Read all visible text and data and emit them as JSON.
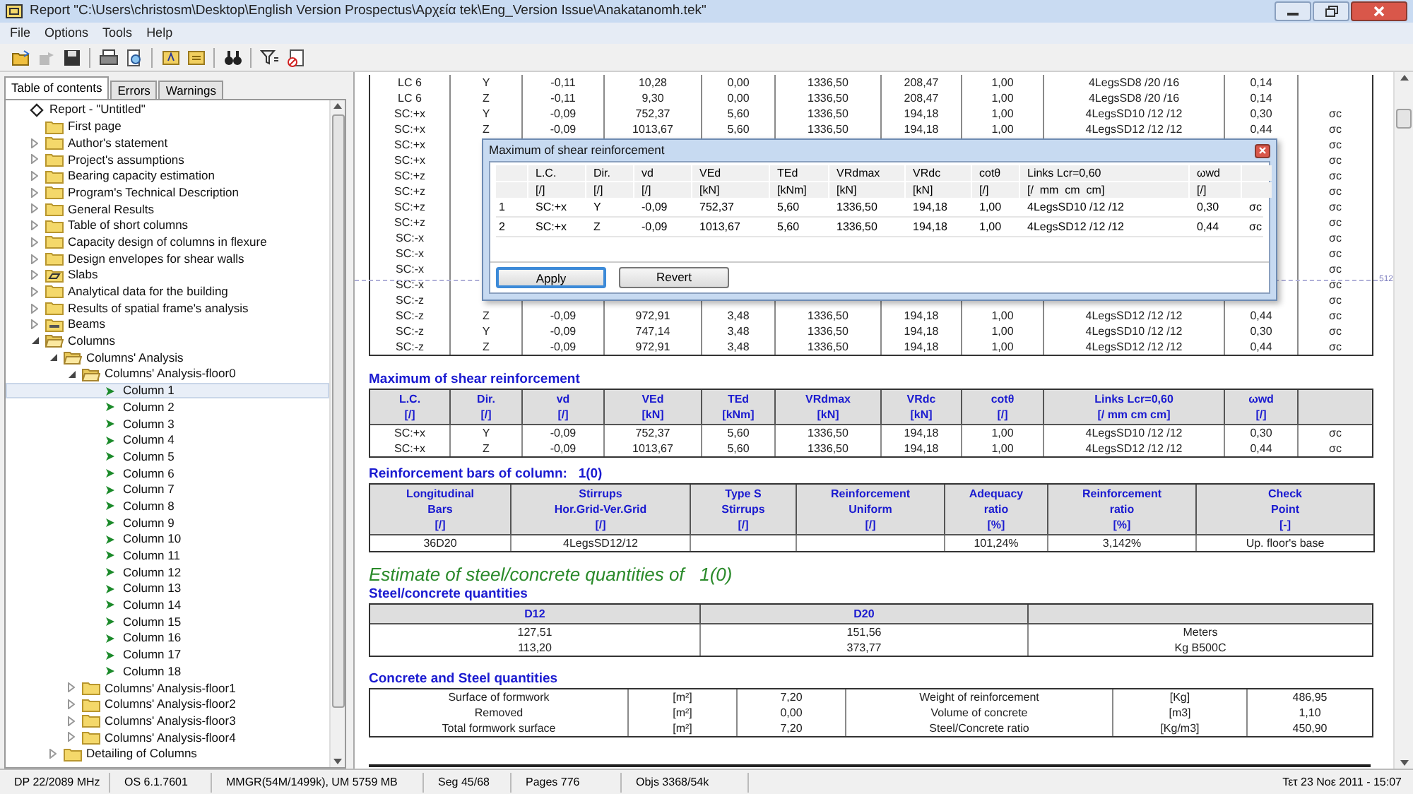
{
  "window": {
    "title": "Report \"C:\\Users\\christosm\\Desktop\\English Version Prospectus\\Αρχεία tek\\Eng_Version Issue\\Anakatanomh.tek\""
  },
  "menu": [
    "File",
    "Options",
    "Tools",
    "Help"
  ],
  "sidebar": {
    "tabs": [
      {
        "label": "Table of contents",
        "selected": true
      },
      {
        "label": "Errors",
        "selected": false
      },
      {
        "label": "Warnings",
        "selected": false
      }
    ],
    "tree": [
      {
        "label": "Report - \"Untitled\"",
        "kind": "diamond",
        "selected": false,
        "children": [
          {
            "label": "First page",
            "kind": "folder",
            "selected": false
          },
          {
            "label": "Author's statement",
            "kind": "folder",
            "expanded": false,
            "selected": false
          },
          {
            "label": "Project's assumptions",
            "kind": "folder",
            "expanded": false,
            "selected": false
          },
          {
            "label": "Bearing capacity estimation",
            "kind": "folder",
            "expanded": false,
            "selected": false
          },
          {
            "label": "Program's Technical Description",
            "kind": "folder",
            "expanded": false,
            "selected": false
          },
          {
            "label": "General Results",
            "kind": "folder",
            "expanded": false,
            "selected": false
          },
          {
            "label": "Table of short columns",
            "kind": "folder",
            "expanded": false,
            "selected": false
          },
          {
            "label": "Capacity design of columns in flexure",
            "kind": "folder",
            "expanded": false,
            "selected": false
          },
          {
            "label": "Design envelopes for shear walls",
            "kind": "folder",
            "expanded": false,
            "selected": false
          },
          {
            "label": "Slabs",
            "kind": "slab",
            "expanded": false,
            "selected": false
          },
          {
            "label": "Analytical data for the building",
            "kind": "folder",
            "expanded": false,
            "selected": false
          },
          {
            "label": "Results of spatial frame's analysis",
            "kind": "folder",
            "expanded": false,
            "selected": false
          },
          {
            "label": "Beams",
            "kind": "beam",
            "expanded": false,
            "selected": false
          },
          {
            "label": "Columns",
            "kind": "open",
            "expanded": true,
            "selected": false,
            "children": [
              {
                "label": "Columns' Analysis",
                "kind": "open",
                "expanded": true,
                "selected": false,
                "children": [
                  {
                    "label": "Columns' Analysis-floor0",
                    "kind": "open",
                    "expanded": true,
                    "selected": false,
                    "children": [
                      {
                        "label": "Column 1",
                        "kind": "arrow",
                        "selected": true
                      },
                      {
                        "label": "Column 2",
                        "kind": "arrow",
                        "selected": false
                      },
                      {
                        "label": "Column 3",
                        "kind": "arrow",
                        "selected": false
                      },
                      {
                        "label": "Column 4",
                        "kind": "arrow",
                        "selected": false
                      },
                      {
                        "label": "Column 5",
                        "kind": "arrow",
                        "selected": false
                      },
                      {
                        "label": "Column 6",
                        "kind": "arrow",
                        "selected": false
                      },
                      {
                        "label": "Column 7",
                        "kind": "arrow",
                        "selected": false
                      },
                      {
                        "label": "Column 8",
                        "kind": "arrow",
                        "selected": false
                      },
                      {
                        "label": "Column 9",
                        "kind": "arrow",
                        "selected": false
                      },
                      {
                        "label": "Column 10",
                        "kind": "arrow",
                        "selected": false
                      },
                      {
                        "label": "Column 11",
                        "kind": "arrow",
                        "selected": false
                      },
                      {
                        "label": "Column 12",
                        "kind": "arrow",
                        "selected": false
                      },
                      {
                        "label": "Column 13",
                        "kind": "arrow",
                        "selected": false
                      },
                      {
                        "label": "Column 14",
                        "kind": "arrow",
                        "selected": false
                      },
                      {
                        "label": "Column 15",
                        "kind": "arrow",
                        "selected": false
                      },
                      {
                        "label": "Column 16",
                        "kind": "arrow",
                        "selected": false
                      },
                      {
                        "label": "Column 17",
                        "kind": "arrow",
                        "selected": false
                      },
                      {
                        "label": "Column 18",
                        "kind": "arrow",
                        "selected": false
                      }
                    ]
                  },
                  {
                    "label": "Columns' Analysis-floor1",
                    "kind": "folder",
                    "expanded": false,
                    "selected": false
                  },
                  {
                    "label": "Columns' Analysis-floor2",
                    "kind": "folder",
                    "expanded": false,
                    "selected": false
                  },
                  {
                    "label": "Columns' Analysis-floor3",
                    "kind": "folder",
                    "expanded": false,
                    "selected": false
                  },
                  {
                    "label": "Columns' Analysis-floor4",
                    "kind": "folder",
                    "expanded": false,
                    "selected": false
                  }
                ]
              },
              {
                "label": "Detailing of Columns",
                "kind": "folder",
                "expanded": false,
                "selected": false
              }
            ]
          }
        ]
      }
    ]
  },
  "report": {
    "top_table": {
      "rows": [
        {
          "lc": "LC 6",
          "values": [
            "Y",
            "-0,11",
            "10,28",
            "0,00",
            "1336,50",
            "208,47",
            "1,00",
            "4LegsSD8 /20 /16",
            "0,14"
          ]
        },
        {
          "lc": "LC 6",
          "values": [
            "Z",
            "-0,11",
            "9,30",
            "0,00",
            "1336,50",
            "208,47",
            "1,00",
            "4LegsSD8 /20 /16",
            "0,14"
          ]
        },
        {
          "lc": "SC:+x",
          "values": [
            "Y",
            "-0,09",
            "752,37",
            "5,60",
            "1336,50",
            "194,18",
            "1,00",
            "4LegsSD10 /12 /12",
            "0,30"
          ],
          "last": "σc"
        },
        {
          "lc": "SC:+x",
          "values": [
            "Z",
            "-0,09",
            "1013,67",
            "5,60",
            "1336,50",
            "194,18",
            "1,00",
            "4LegsSD12 /12 /12",
            "0,44"
          ],
          "last": "σc"
        },
        {
          "lc": "SC:+x",
          "last": "σc"
        },
        {
          "lc": "SC:+x",
          "last": "σc"
        },
        {
          "lc": "SC:+z",
          "last": "σc"
        },
        {
          "lc": "SC:+z",
          "last": "σc"
        },
        {
          "lc": "SC:+z",
          "last": "σc"
        },
        {
          "lc": "SC:+z",
          "last": "σc"
        },
        {
          "lc": "SC:-x",
          "last": "σc"
        },
        {
          "lc": "SC:-x",
          "last": "σc"
        },
        {
          "lc": "SC:-x",
          "last": "σc"
        },
        {
          "lc": "SC:-x",
          "last": "σc"
        },
        {
          "lc": "SC:-z",
          "last": "σc"
        },
        {
          "lc": "SC:-z",
          "values": [
            "Z",
            "-0,09",
            "972,91",
            "3,48",
            "1336,50",
            "194,18",
            "1,00",
            "4LegsSD12 /12 /12",
            "0,44"
          ],
          "last": "σc"
        },
        {
          "lc": "SC:-z",
          "values": [
            "Y",
            "-0,09",
            "747,14",
            "3,48",
            "1336,50",
            "194,18",
            "1,00",
            "4LegsSD10 /12 /12",
            "0,30"
          ],
          "last": "σc"
        },
        {
          "lc": "SC:-z",
          "values": [
            "Z",
            "-0,09",
            "972,91",
            "3,48",
            "1336,50",
            "194,18",
            "1,00",
            "4LegsSD12 /12 /12",
            "0,44"
          ],
          "last": "σc"
        }
      ]
    },
    "page_marker": "512",
    "shear_table": {
      "title": "Maximum of shear reinforcement",
      "header": [
        [
          "L.C.",
          "[/]"
        ],
        [
          "Dir.",
          "[/]"
        ],
        [
          "vd",
          "[/]"
        ],
        [
          "VEd",
          "[kN]"
        ],
        [
          "TEd",
          "[kNm]"
        ],
        [
          "VRdmax",
          "[kN]"
        ],
        [
          "VRdc",
          "[kN]"
        ],
        [
          "cotθ",
          "[/]"
        ],
        [
          "Links Lcr=0,60",
          "[/  mm  cm  cm]"
        ],
        [
          "ωwd",
          "[/]"
        ]
      ],
      "rows": [
        [
          "SC:+x",
          "Y",
          "-0,09",
          "752,37",
          "5,60",
          "1336,50",
          "194,18",
          "1,00",
          "4LegsSD10 /12 /12",
          "0,30",
          "σc"
        ],
        [
          "SC:+x",
          "Z",
          "-0,09",
          "1013,67",
          "5,60",
          "1336,50",
          "194,18",
          "1,00",
          "4LegsSD12 /12 /12",
          "0,44",
          "σc"
        ]
      ]
    },
    "bars_table": {
      "title": "Reinforcement bars of column:   1(0)",
      "header": [
        [
          "Longitudinal",
          "Bars",
          "[/]"
        ],
        [
          "Stirrups",
          "Hor.Grid-Ver.Grid",
          "[/]"
        ],
        [
          "Type S",
          "Stirrups",
          "[/]"
        ],
        [
          "Reinforcement",
          "Uniform",
          "[/]"
        ],
        [
          "Adequacy",
          "ratio",
          "[%]"
        ],
        [
          "Reinforcement",
          "ratio",
          "[%]"
        ],
        [
          "Check",
          "Point",
          "[-]"
        ]
      ],
      "rows": [
        [
          "36D20",
          "4LegsSD12/12",
          null,
          null,
          "101,24%",
          "3,142%",
          "Up. floor's base"
        ]
      ]
    },
    "estimate_title": "Estimate of steel/concrete quantities of   1(0)",
    "steel_table": {
      "title": "Steel/concrete quantities",
      "header": [
        [
          "D12"
        ],
        [
          "D20"
        ]
      ],
      "rows": [
        [
          "127,51",
          "151,56",
          "Meters"
        ],
        [
          "113,20",
          "373,77",
          "Kg B500C"
        ]
      ]
    },
    "concrete_table": {
      "title": "Concrete and Steel quantities",
      "rows": [
        [
          "Surface of formwork",
          "[m²]",
          "7,20",
          "Weight of reinforcement",
          "[Kg]",
          "486,95"
        ],
        [
          "Removed",
          "[m²]",
          "0,00",
          "Volume of concrete",
          "[m3]",
          "1,10"
        ],
        [
          "Total formwork surface",
          "[m²]",
          "7,20",
          "Steel/Concrete ratio",
          "[Kg/m3]",
          "450,90"
        ]
      ]
    }
  },
  "dialog": {
    "title": "Maximum of shear reinforcement",
    "header": [
      "L.C.",
      "Dir.",
      "vd",
      "VEd",
      "TEd",
      "VRdmax",
      "VRdc",
      "cotθ",
      "Links Lcr=0,60",
      "ωwd"
    ],
    "units": [
      "[/]",
      "[/]",
      "[/]",
      "[kN]",
      "[kNm]",
      "[kN]",
      "[kN]",
      "[/]",
      "[/  mm  cm  cm]",
      "[/]"
    ],
    "rows": [
      {
        "index": "1",
        "cells": [
          "SC:+x",
          "Y",
          "-0,09",
          "752,37",
          "5,60",
          "1336,50",
          "194,18",
          "1,00",
          "4LegsSD10 /12 /12",
          "0,30",
          "σc"
        ]
      },
      {
        "index": "2",
        "cells": [
          "SC:+x",
          "Z",
          "-0,09",
          "1013,67",
          "5,60",
          "1336,50",
          "194,18",
          "1,00",
          "4LegsSD12 /12 /12",
          "0,44",
          "σc"
        ]
      }
    ],
    "buttons": [
      {
        "label": "Apply",
        "default": true
      },
      {
        "label": "Revert",
        "default": false
      }
    ]
  },
  "status_bar": [
    "DP 22/2089 MHz",
    "OS 6.1.7601",
    "MMGR(54M/1499k), UM 5759 MB",
    "Seg 45/68",
    "Pages 776",
    "Objs 3368/54k"
  ],
  "clock": "Τετ 23 Νοε 2011 - 15:07"
}
